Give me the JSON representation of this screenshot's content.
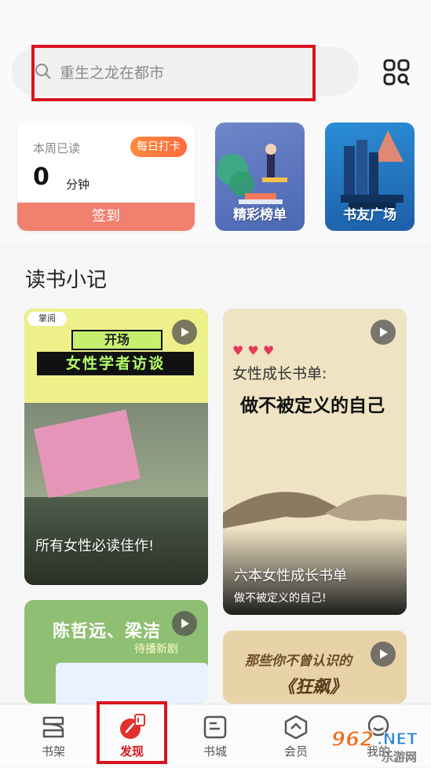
{
  "search": {
    "placeholder": "重生之龙在都市"
  },
  "reading": {
    "label": "本周已读",
    "badge": "每日打卡",
    "minutes": "0",
    "unit": "分钟",
    "signin": "签到"
  },
  "promos": [
    {
      "label": "精彩榜单"
    },
    {
      "label": "书友广场"
    }
  ],
  "section": {
    "title": "读书小记"
  },
  "notes": [
    {
      "title": "所有女性必读佳作!",
      "cover_tag": "开场",
      "cover_headline": "女性学者访谈",
      "logo": "掌阅"
    },
    {
      "title": "六本女性成长书单",
      "subtitle": "做不被定义的自己!",
      "cover_line1": "女性成长书单:",
      "cover_line2": "做不被定义的自己"
    },
    {
      "cover_headline": "陈哲远、梁洁",
      "cover_sub": "待播新剧"
    },
    {
      "cover_line1": "那些你不曾认识的",
      "cover_line2": "《狂飙》"
    }
  ],
  "tabs": [
    {
      "label": "书架"
    },
    {
      "label": "发现"
    },
    {
      "label": "书城"
    },
    {
      "label": "会员"
    },
    {
      "label": "我的"
    }
  ],
  "colors": {
    "accent": "#d9141c",
    "signin": "#f2806f",
    "badge": "#ff7a3d"
  },
  "watermark": {
    "brand": "962",
    "suffix": ".NET",
    "cn": "乐游网"
  }
}
